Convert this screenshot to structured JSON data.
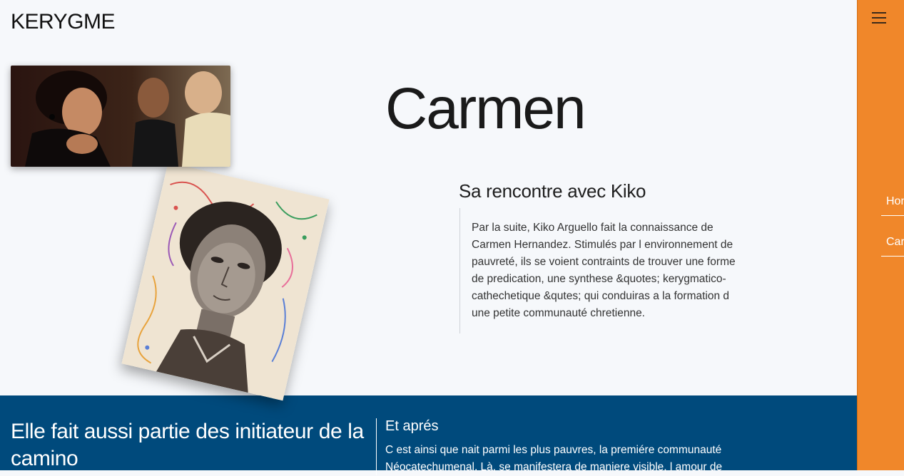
{
  "header": {
    "logo": "KERYGME"
  },
  "hero": {
    "title": "Carmen",
    "subtitle": "Sa rencontre avec Kiko",
    "paragraph": "Par la suite, Kiko Arguello fait la connaissance de Carmen Hernandez. Stimulés par l environnement de pauvreté, ils se voient contraints de trouver une forme de predication, une synthese &quotes; kerygmatico-cathechetique &qutes; qui conduiras a la formation d une petite communauté chretienne."
  },
  "band": {
    "title": "Elle fait aussi partie des initiateur de la camino",
    "subtitle": "Et aprés",
    "text": "C est ainsi que nait parmi les plus pauvres, la premiére communauté Néocatechumenal. Là, se manifestera de maniere visible, l amour de"
  },
  "sidebar": {
    "items": [
      {
        "label": "Home"
      },
      {
        "label": "Carmen"
      }
    ]
  },
  "colors": {
    "accent_orange": "#f0872a",
    "band_blue": "#004a7c",
    "background": "#f6f8fb"
  },
  "icons": {
    "menu": "hamburger-icon"
  }
}
